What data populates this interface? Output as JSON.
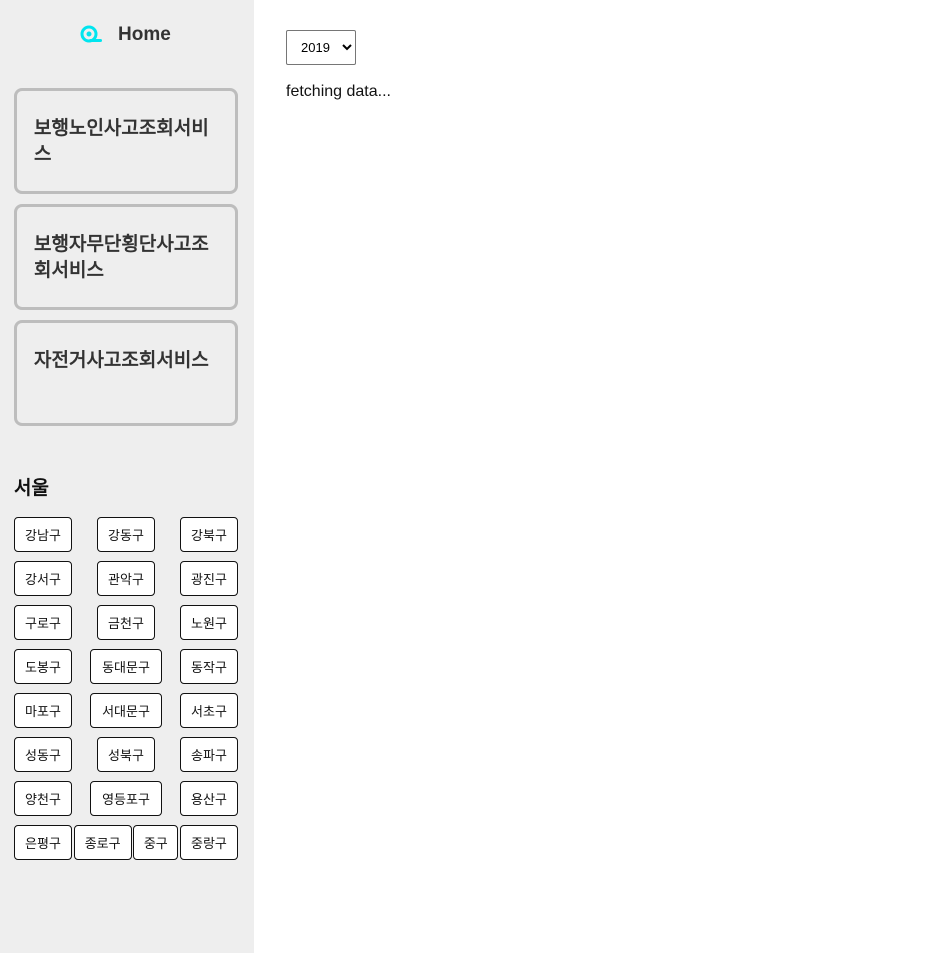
{
  "sidebar": {
    "home_label": "Home",
    "services": [
      {
        "label": "보행노인사고조회서비스"
      },
      {
        "label": "보행자무단횡단사고조회서비스"
      },
      {
        "label": "자전거사고조회서비스"
      }
    ],
    "region_title": "서울",
    "districts": [
      "강남구",
      "강동구",
      "강북구",
      "강서구",
      "관악구",
      "광진구",
      "구로구",
      "금천구",
      "노원구",
      "도봉구",
      "동대문구",
      "동작구",
      "마포구",
      "서대문구",
      "서초구",
      "성동구",
      "성북구",
      "송파구",
      "양천구",
      "영등포구",
      "용산구",
      "은평구",
      "종로구",
      "중구",
      "중랑구"
    ]
  },
  "main": {
    "year_selected": "2019",
    "status": "fetching data..."
  },
  "colors": {
    "sidebar_bg": "#eeeeee",
    "card_border": "#bdbdbd",
    "home_icon": "#00e5ef"
  }
}
